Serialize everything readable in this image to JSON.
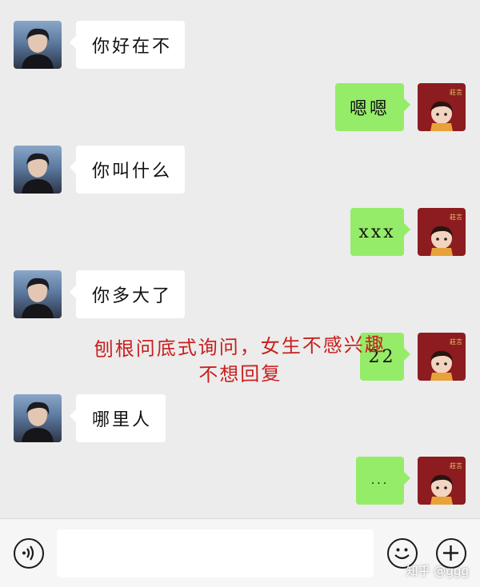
{
  "messages": [
    {
      "side": "left",
      "text": "你好在不"
    },
    {
      "side": "right",
      "text": "嗯嗯"
    },
    {
      "side": "left",
      "text": "你叫什么"
    },
    {
      "side": "right",
      "text": "xxx"
    },
    {
      "side": "left",
      "text": "你多大了"
    },
    {
      "side": "right",
      "text": "22"
    },
    {
      "side": "left",
      "text": "哪里人"
    },
    {
      "side": "right",
      "text": "..."
    }
  ],
  "annotation": {
    "line1": "刨根问底式询问，女生不感兴趣",
    "line2": "不想回复"
  },
  "input_bar": {
    "voice_icon": "voice-icon",
    "emoji_icon": "emoji-icon",
    "plus_icon": "plus-icon",
    "value": ""
  },
  "watermark": "知乎 @ggg",
  "colors": {
    "background": "#ececec",
    "self_bubble": "#95ec69",
    "other_bubble": "#ffffff",
    "annotation": "#c8201e"
  }
}
